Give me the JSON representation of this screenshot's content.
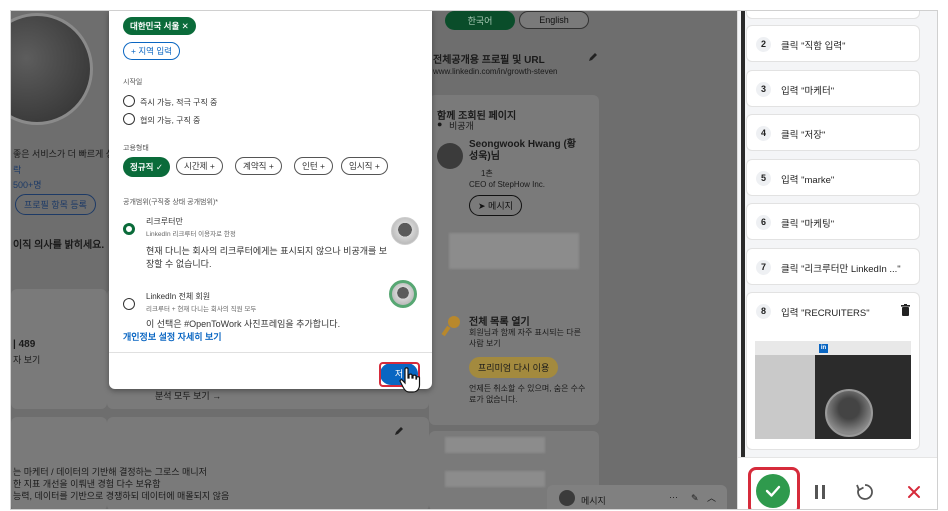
{
  "background_left": {
    "line1": "좋은 서비스가 더 빠르게 성",
    "line2": "락",
    "line3": "500+명",
    "profile_button": "프로필 항목 등록",
    "intent": "이직 의사를 밝히세요.",
    "count": "| 489",
    "count_sub": "자 보기",
    "desc1": "는 마케터 / 데이터의 기반해 결정하는 그로스 매니저",
    "desc2": "한 지표 개선을 이뤄낸 경험 다수 보유함",
    "desc3": "능력, 데이터를 기반으로 경쟁하되 데이터에 매몰되지 않음"
  },
  "background_mid": {
    "analytics_link": "분석 모두 보기 →"
  },
  "background_right": {
    "lang_korean": "한국어",
    "lang_english": "English",
    "public_profile_title": "전체공개용 프로필 및 URL",
    "profile_url": "www.linkedin.com/in/growth-steven",
    "viewed_title": "함께 조회된 페이지",
    "viewed_sub": "비공개",
    "person_name": "Seongwook Hwang (황성욱)님",
    "person_degree": "1촌",
    "person_title": "CEO of StepHow Inc.",
    "message_button": "메시지",
    "premium_title": "전체 목록 열기",
    "premium_desc": "회원님과 함께 자주 표시되는 다른 사람 보기",
    "premium_button": "프리미엄 다시 이용",
    "premium_note": "언제든 취소할 수 있으며, 숨은 수수료가 없습니다.",
    "msg_bar_label": "메시지",
    "msg_bar_dots": "···"
  },
  "modal": {
    "location_chip": "대한민국 서울",
    "add_location": "+ 지역 입력",
    "start_label": "시작일",
    "start_opt1": "즉시 가능, 적극 구직 중",
    "start_opt2": "협의 가능, 구직 중",
    "employment_label": "고용형태",
    "emp_fulltime": "정규직 ✓",
    "emp_parttime": "시간제 +",
    "emp_contract": "계약직 +",
    "emp_intern": "인턴 +",
    "emp_temp": "임시직 +",
    "visibility_label": "공개범위(구직중 상태 공개범위)*",
    "vis1_title": "리크루터만",
    "vis1_sub": "LinkedIn 리크루터 이용자로 한정",
    "vis1_desc": "현재 다니는 회사의 리크루터에게는 표시되지 않으나 비공개를 보장할 수 없습니다.",
    "vis2_title": "LinkedIn 전체 회원",
    "vis2_sub": "리크루터 + 현재 다니는 회사의 직원 모두",
    "vis2_desc": "이 선택은 #OpenToWork 사진프레임을 추가합니다.",
    "privacy_link": "개인정보 설정 자세히 보기",
    "save_button": "저"
  },
  "steps": [
    {
      "num": "2",
      "label": "클릭 \"직함 입력\""
    },
    {
      "num": "3",
      "label": "입력 \"마케터\""
    },
    {
      "num": "4",
      "label": "클릭 \"저장\""
    },
    {
      "num": "5",
      "label": "입력 \"marke\""
    },
    {
      "num": "6",
      "label": "클릭 \"마케팅\""
    },
    {
      "num": "7",
      "label": "클릭 \"리크루터만 LinkedIn ...\""
    },
    {
      "num": "8",
      "label": "입력 \"RECRUITERS\""
    }
  ],
  "thumb_logo": "in",
  "colors": {
    "accent_green": "#2f9a4d",
    "linkedin_blue": "#0a66c2",
    "highlight_red": "#d62b3b",
    "chip_green": "#0a6b3a"
  }
}
